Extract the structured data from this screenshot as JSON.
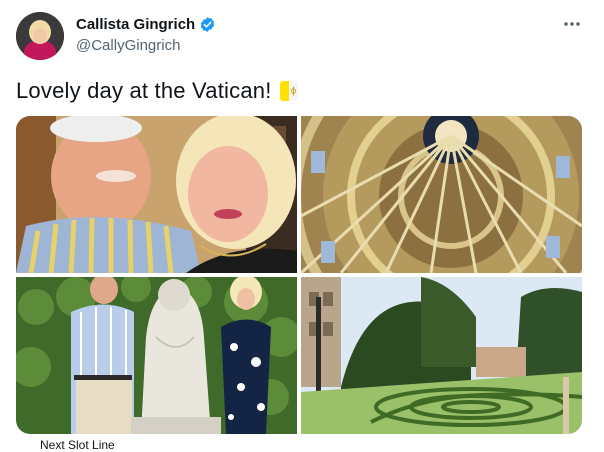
{
  "author": {
    "name": "Callista Gingrich",
    "handle": "@CallyGingrich",
    "verified": true
  },
  "tweet": {
    "text": "Lovely day at the Vatican!",
    "emoji": "vatican-flag"
  },
  "media": [
    {
      "name": "selfie-photo"
    },
    {
      "name": "dome-photo"
    },
    {
      "name": "statue-photo"
    },
    {
      "name": "gardens-photo"
    }
  ],
  "colors": {
    "verified_blue": "#1d9bf0",
    "secondary_text": "#536471",
    "flag_yellow": "#ffe000"
  },
  "footer": {
    "next_label": "Next Slot Line"
  }
}
